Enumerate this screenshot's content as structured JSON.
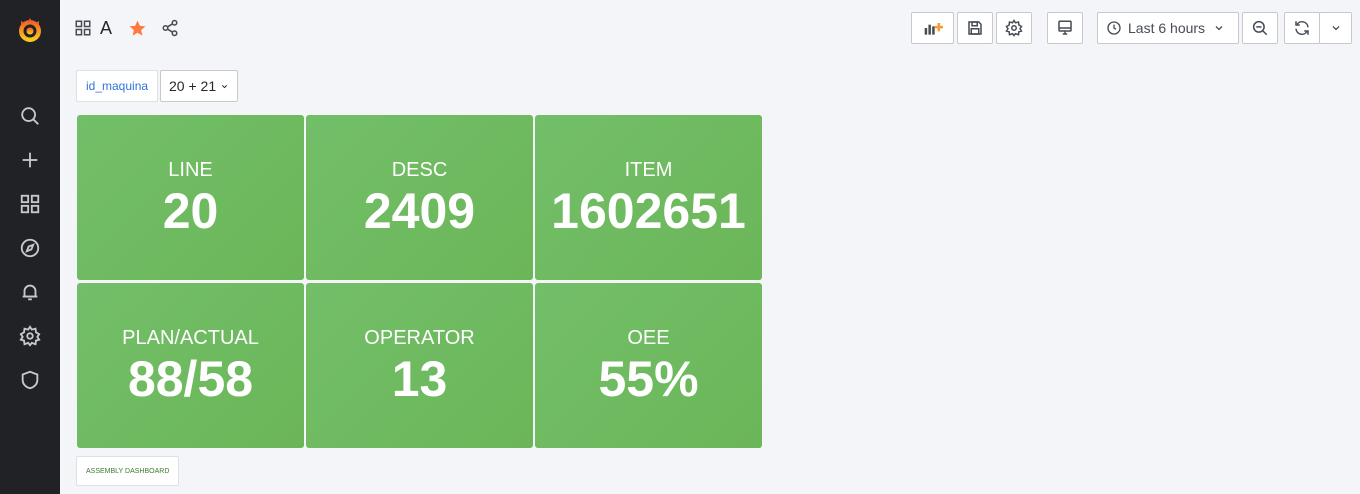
{
  "dashboard": {
    "title": "A"
  },
  "time_picker": {
    "label": "Last 6 hours"
  },
  "variable": {
    "name": "id_maquina",
    "value": "20 + 21"
  },
  "panels": [
    {
      "title": "LINE",
      "value": "20"
    },
    {
      "title": "DESC",
      "value": "2409"
    },
    {
      "title": "ITEM",
      "value": "1602651"
    },
    {
      "title": "PLAN/ACTUAL",
      "value": "88/58"
    },
    {
      "title": "OPERATOR",
      "value": "13"
    },
    {
      "title": "OEE",
      "value": "55%"
    }
  ],
  "footer_link": {
    "label": "ASSEMBLY DASHBOARD"
  },
  "colors": {
    "panel_green": "#73bf69",
    "sidebar": "#202226",
    "star": "#ff7941",
    "accent_orange": "#f89b35"
  }
}
